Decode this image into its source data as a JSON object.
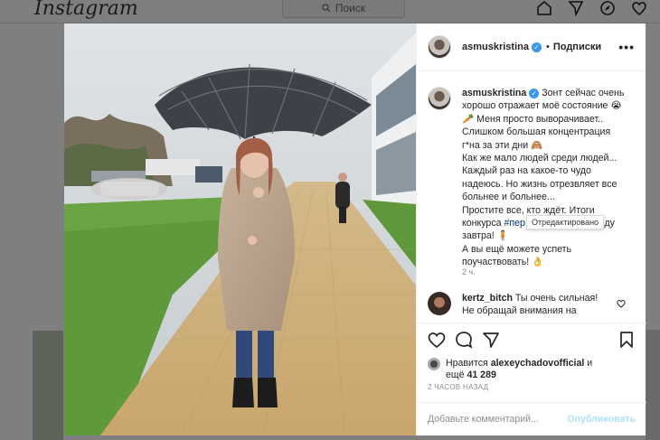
{
  "header": {
    "logo": "Instagram",
    "search_placeholder": "Поиск"
  },
  "post": {
    "author": "asmuskristina",
    "follow_label": "Подписки",
    "more_label": "•••",
    "caption_lines": [
      "Зонт сейчас очень",
      "хорошо отражает моё состояние 😭",
      "🥕 Меня просто выворачивает..",
      "Слишком большая концентрация",
      "г*на за эти дни 🙈",
      "Как же мало людей среди людей...",
      "Каждый раз на какое-то чудо",
      "надеюсь. Но жизнь отрезвляет все",
      "больнее и больнее...",
      "Простите все, кто ждёт. Итоги"
    ],
    "caption_hashtag_line_pre": "конкурса",
    "caption_hashtag": "#пер",
    "caption_hashtag_line_post": "реду",
    "caption_tail_lines": [
      "завтра! 🧍",
      "А вы ещё можете успеть",
      "поучаствовать! 👌"
    ],
    "caption_time": "2 ч.",
    "tooltip": "Отредактировано"
  },
  "comment": {
    "author": "kertz_bitch",
    "text_line1": "Ты очень сильная!",
    "text_line2": "Не обращай внимания на"
  },
  "likes": {
    "prefix": "Нравится",
    "user": "alexeychadovofficial",
    "suffix": "и",
    "more_prefix": "ещё",
    "count": "41 289"
  },
  "posted_ago": "2 ЧАСОВ НАЗАД",
  "comment_box": {
    "placeholder": "Добавьте комментарий...",
    "publish_label": "Опубликовать"
  },
  "colors": {
    "verified": "#3897f0",
    "hashtag": "#00376b",
    "publish_disabled": "#b2dffc"
  }
}
